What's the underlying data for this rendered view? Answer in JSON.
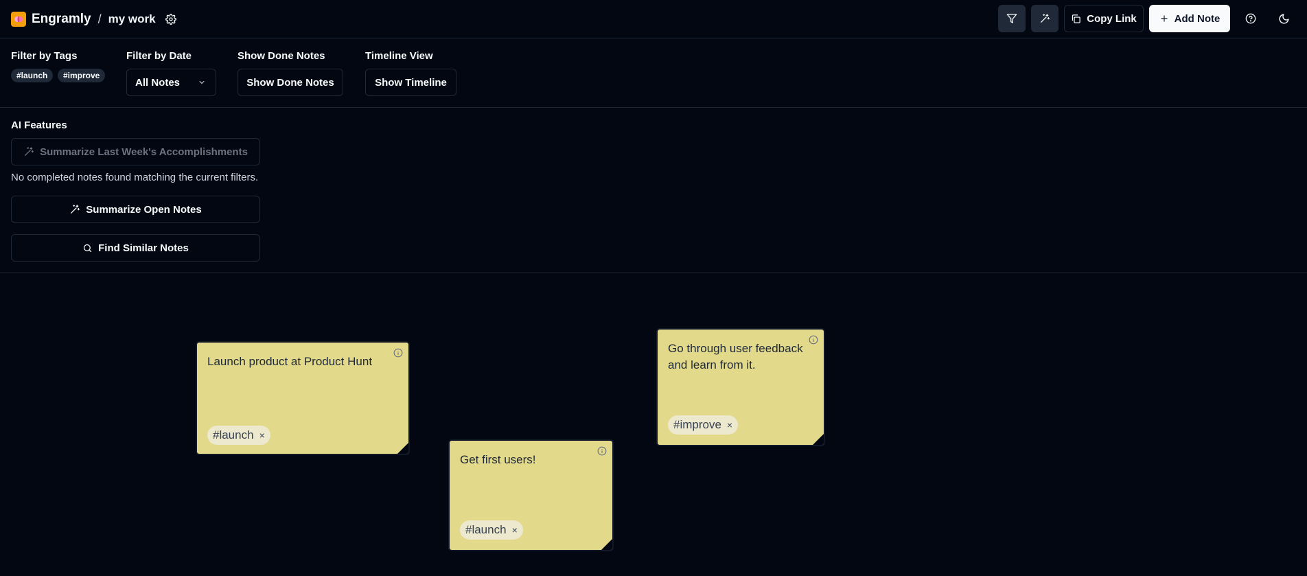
{
  "header": {
    "app_name": "Engramly",
    "separator": "/",
    "board_name": "my work",
    "copy_link_label": "Copy Link",
    "add_note_label": "Add Note"
  },
  "filters": {
    "tags_label": "Filter by Tags",
    "tags": [
      "#launch",
      "#improve"
    ],
    "date_label": "Filter by Date",
    "date_selected": "All Notes",
    "done_label": "Show Done Notes",
    "done_button": "Show Done Notes",
    "timeline_label": "Timeline View",
    "timeline_button": "Show Timeline"
  },
  "ai": {
    "title": "AI Features",
    "summarize_week_label": "Summarize Last Week's Accomplishments",
    "no_completed_message": "No completed notes found matching the current filters.",
    "summarize_open_label": "Summarize Open Notes",
    "find_similar_label": "Find Similar Notes"
  },
  "notes": [
    {
      "text": "Launch product at Product Hunt",
      "tag": "#launch",
      "tag_remove": "×"
    },
    {
      "text": "Get first users!",
      "tag": "#launch",
      "tag_remove": "×"
    },
    {
      "text": "Go through user feedback and learn from it.",
      "tag": "#improve",
      "tag_remove": "×"
    }
  ],
  "colors": {
    "background": "#030712",
    "border": "#1f2937",
    "note_yellow": "#e2d98a",
    "logo": "#f59e0b"
  },
  "icons": {
    "logo": "brain-icon",
    "settings": "gear-icon",
    "filter": "filter-icon",
    "ai": "magic-wand-icon",
    "copy": "copy-icon",
    "add": "plus-icon",
    "help": "help-circle-icon",
    "theme": "moon-icon",
    "dropdown": "chevron-down-icon",
    "search": "search-icon",
    "info": "info-icon"
  }
}
